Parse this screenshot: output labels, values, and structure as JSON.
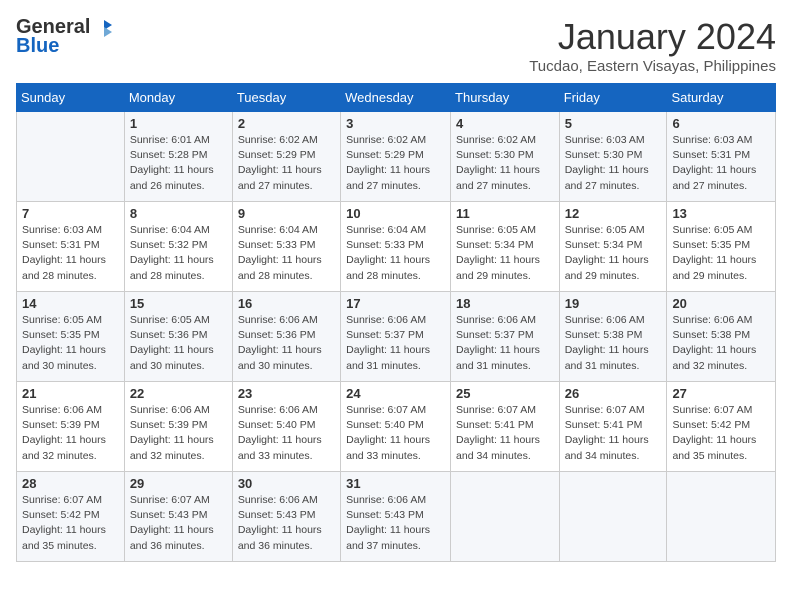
{
  "header": {
    "logo_line1": "General",
    "logo_line2": "Blue",
    "title": "January 2024",
    "subtitle": "Tucdao, Eastern Visayas, Philippines"
  },
  "days_of_week": [
    "Sunday",
    "Monday",
    "Tuesday",
    "Wednesday",
    "Thursday",
    "Friday",
    "Saturday"
  ],
  "weeks": [
    [
      {
        "day": "",
        "info": ""
      },
      {
        "day": "1",
        "info": "Sunrise: 6:01 AM\nSunset: 5:28 PM\nDaylight: 11 hours\nand 26 minutes."
      },
      {
        "day": "2",
        "info": "Sunrise: 6:02 AM\nSunset: 5:29 PM\nDaylight: 11 hours\nand 27 minutes."
      },
      {
        "day": "3",
        "info": "Sunrise: 6:02 AM\nSunset: 5:29 PM\nDaylight: 11 hours\nand 27 minutes."
      },
      {
        "day": "4",
        "info": "Sunrise: 6:02 AM\nSunset: 5:30 PM\nDaylight: 11 hours\nand 27 minutes."
      },
      {
        "day": "5",
        "info": "Sunrise: 6:03 AM\nSunset: 5:30 PM\nDaylight: 11 hours\nand 27 minutes."
      },
      {
        "day": "6",
        "info": "Sunrise: 6:03 AM\nSunset: 5:31 PM\nDaylight: 11 hours\nand 27 minutes."
      }
    ],
    [
      {
        "day": "7",
        "info": "Sunrise: 6:03 AM\nSunset: 5:31 PM\nDaylight: 11 hours\nand 28 minutes."
      },
      {
        "day": "8",
        "info": "Sunrise: 6:04 AM\nSunset: 5:32 PM\nDaylight: 11 hours\nand 28 minutes."
      },
      {
        "day": "9",
        "info": "Sunrise: 6:04 AM\nSunset: 5:33 PM\nDaylight: 11 hours\nand 28 minutes."
      },
      {
        "day": "10",
        "info": "Sunrise: 6:04 AM\nSunset: 5:33 PM\nDaylight: 11 hours\nand 28 minutes."
      },
      {
        "day": "11",
        "info": "Sunrise: 6:05 AM\nSunset: 5:34 PM\nDaylight: 11 hours\nand 29 minutes."
      },
      {
        "day": "12",
        "info": "Sunrise: 6:05 AM\nSunset: 5:34 PM\nDaylight: 11 hours\nand 29 minutes."
      },
      {
        "day": "13",
        "info": "Sunrise: 6:05 AM\nSunset: 5:35 PM\nDaylight: 11 hours\nand 29 minutes."
      }
    ],
    [
      {
        "day": "14",
        "info": "Sunrise: 6:05 AM\nSunset: 5:35 PM\nDaylight: 11 hours\nand 30 minutes."
      },
      {
        "day": "15",
        "info": "Sunrise: 6:05 AM\nSunset: 5:36 PM\nDaylight: 11 hours\nand 30 minutes."
      },
      {
        "day": "16",
        "info": "Sunrise: 6:06 AM\nSunset: 5:36 PM\nDaylight: 11 hours\nand 30 minutes."
      },
      {
        "day": "17",
        "info": "Sunrise: 6:06 AM\nSunset: 5:37 PM\nDaylight: 11 hours\nand 31 minutes."
      },
      {
        "day": "18",
        "info": "Sunrise: 6:06 AM\nSunset: 5:37 PM\nDaylight: 11 hours\nand 31 minutes."
      },
      {
        "day": "19",
        "info": "Sunrise: 6:06 AM\nSunset: 5:38 PM\nDaylight: 11 hours\nand 31 minutes."
      },
      {
        "day": "20",
        "info": "Sunrise: 6:06 AM\nSunset: 5:38 PM\nDaylight: 11 hours\nand 32 minutes."
      }
    ],
    [
      {
        "day": "21",
        "info": "Sunrise: 6:06 AM\nSunset: 5:39 PM\nDaylight: 11 hours\nand 32 minutes."
      },
      {
        "day": "22",
        "info": "Sunrise: 6:06 AM\nSunset: 5:39 PM\nDaylight: 11 hours\nand 32 minutes."
      },
      {
        "day": "23",
        "info": "Sunrise: 6:06 AM\nSunset: 5:40 PM\nDaylight: 11 hours\nand 33 minutes."
      },
      {
        "day": "24",
        "info": "Sunrise: 6:07 AM\nSunset: 5:40 PM\nDaylight: 11 hours\nand 33 minutes."
      },
      {
        "day": "25",
        "info": "Sunrise: 6:07 AM\nSunset: 5:41 PM\nDaylight: 11 hours\nand 34 minutes."
      },
      {
        "day": "26",
        "info": "Sunrise: 6:07 AM\nSunset: 5:41 PM\nDaylight: 11 hours\nand 34 minutes."
      },
      {
        "day": "27",
        "info": "Sunrise: 6:07 AM\nSunset: 5:42 PM\nDaylight: 11 hours\nand 35 minutes."
      }
    ],
    [
      {
        "day": "28",
        "info": "Sunrise: 6:07 AM\nSunset: 5:42 PM\nDaylight: 11 hours\nand 35 minutes."
      },
      {
        "day": "29",
        "info": "Sunrise: 6:07 AM\nSunset: 5:43 PM\nDaylight: 11 hours\nand 36 minutes."
      },
      {
        "day": "30",
        "info": "Sunrise: 6:06 AM\nSunset: 5:43 PM\nDaylight: 11 hours\nand 36 minutes."
      },
      {
        "day": "31",
        "info": "Sunrise: 6:06 AM\nSunset: 5:43 PM\nDaylight: 11 hours\nand 37 minutes."
      },
      {
        "day": "",
        "info": ""
      },
      {
        "day": "",
        "info": ""
      },
      {
        "day": "",
        "info": ""
      }
    ]
  ]
}
